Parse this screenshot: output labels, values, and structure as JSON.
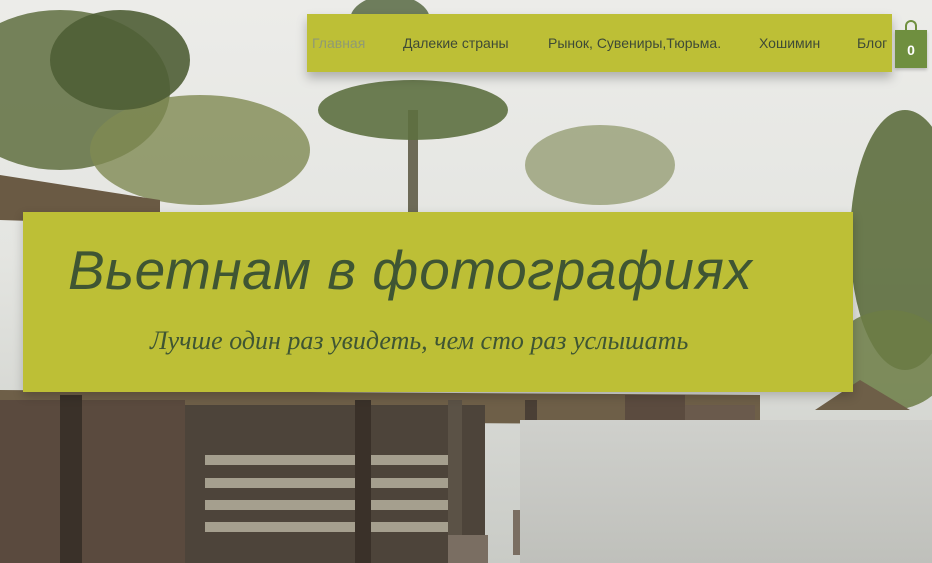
{
  "nav": {
    "items": [
      {
        "label": "Главная",
        "active": true
      },
      {
        "label": "Далекие страны",
        "active": false
      },
      {
        "label": "Рынок, Сувениры,Тюрьма.",
        "active": false
      },
      {
        "label": "Хошимин",
        "active": false
      },
      {
        "label": "Блог",
        "active": false
      }
    ]
  },
  "cart": {
    "count": "0",
    "icon": "shopping-bag-icon"
  },
  "hero": {
    "title": "Вьетнам в фотографиях",
    "subtitle": "Лучше один раз увидеть, чем сто раз услышать"
  },
  "colors": {
    "nav_bg": "#bdbf36",
    "hero_bg": "#bdbf36",
    "text": "#3e4a36",
    "active_link": "#8f9a74",
    "cart_bg": "#6f8f3f"
  }
}
